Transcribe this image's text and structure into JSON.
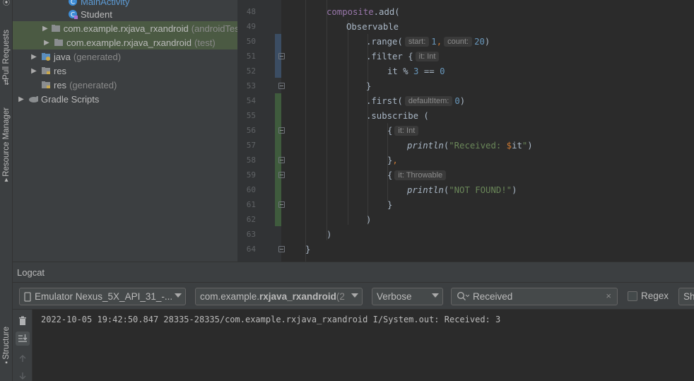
{
  "toolstrip": {
    "pull_requests": "Pull Requests",
    "resource_manager": "Resource Manager",
    "structure": "Structure"
  },
  "project_tree": [
    {
      "label": "MainActivity",
      "icon": "kotlin-class-icon",
      "expand": "",
      "extra": ""
    },
    {
      "label": "Student",
      "icon": "kotlin-class-icon",
      "expand": "",
      "extra": ""
    },
    {
      "label": "com.example.rxjava_rxandroid",
      "icon": "package-icon",
      "expand": "collapsed",
      "extra": "(androidTest)"
    },
    {
      "label": "com.example.rxjava_rxandroid",
      "icon": "package-icon",
      "expand": "collapsed",
      "extra": "(test)"
    },
    {
      "label": "java",
      "icon": "generated-folder-icon",
      "expand": "collapsed",
      "extra": "(generated)"
    },
    {
      "label": "res",
      "icon": "res-folder-icon",
      "expand": "collapsed",
      "extra": ""
    },
    {
      "label": "res",
      "icon": "res-folder-icon",
      "expand": "",
      "extra": "(generated)"
    },
    {
      "label": "Gradle Scripts",
      "icon": "gradle-icon",
      "expand": "collapsed",
      "extra": ""
    }
  ],
  "editor": {
    "line_numbers": [
      "48",
      "49",
      "50",
      "51",
      "52",
      "53",
      "54",
      "55",
      "56",
      "57",
      "58",
      "59",
      "60",
      "61",
      "62",
      "63",
      "64"
    ],
    "lines": {
      "l48_var": "composite",
      "l48_rest": ".add(",
      "l49": "Observable",
      "l50_a": ".range(",
      "l50_hint1": "start:",
      "l50_v1": "1",
      "l50_sep": ",",
      "l50_hint2": "count:",
      "l50_v2": "20",
      "l50_close": ")",
      "l51_a": ".filter {",
      "l51_hint": "it: Int",
      "l52_a": "it % ",
      "l52_n1": "3",
      "l52_b": " == ",
      "l52_n2": "0",
      "l53": "}",
      "l54_a": ".first(",
      "l54_hint": "defaultItem:",
      "l54_v": "0",
      "l54_close": ")",
      "l55": ".subscribe (",
      "l56_a": "{",
      "l56_hint": "it: Int",
      "l57_fn": "println",
      "l57_a": "(",
      "l57_str1": "\"Received: ",
      "l57_tmpl": "$",
      "l57_it": "it",
      "l57_str2": "\"",
      "l57_close": ")",
      "l58_a": "}",
      "l58_comma": ",",
      "l59_a": "{",
      "l59_hint": "it: Throwable",
      "l60_fn": "println",
      "l60_a": "(",
      "l60_str": "\"NOT FOUND!\"",
      "l60_close": ")",
      "l61": "}",
      "l62": ")",
      "l63": ")",
      "l64": "}"
    }
  },
  "logcat": {
    "title": "Logcat",
    "device": "Emulator Nexus_5X_API_31_-...",
    "process_prefix": "com.example.",
    "process_bold": "rxjava_rxandroid",
    "process_suffix": " (2",
    "level": "Verbose",
    "search_value": "Received",
    "regex_label": "Regex",
    "show_only_label": "Sh",
    "log_line": "2022-10-05 19:42:50.847 28335-28335/com.example.rxjava_rxandroid I/System.out: Received: 3"
  },
  "colors": {
    "selection": "#4b5a43",
    "change_marker_blue": "#3b4d63",
    "change_marker_green": "#3f5b3d"
  }
}
